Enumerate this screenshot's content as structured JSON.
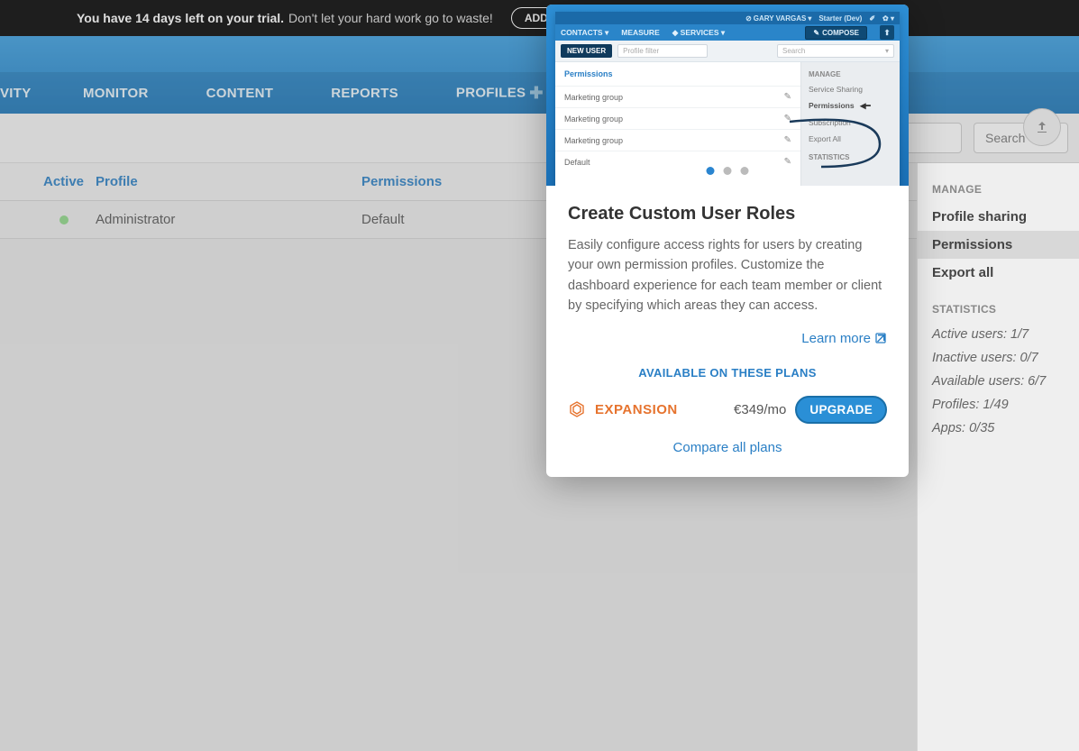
{
  "trial": {
    "bold": "You have 14 days left on your trial.",
    "light": "Don't let your hard work go to waste!",
    "add_button": "ADD BI"
  },
  "nav": {
    "tabs": [
      "VITY",
      "MONITOR",
      "CONTENT",
      "REPORTS",
      "PROFILES"
    ]
  },
  "toolbar": {
    "search_placeholder": "Search"
  },
  "table": {
    "headers": {
      "active": "Active",
      "profile": "Profile",
      "permissions": "Permissions"
    },
    "rows": [
      {
        "profile": "Administrator",
        "permissions": "Default"
      }
    ]
  },
  "sidebar": {
    "manage_title": "MANAGE",
    "manage_items": [
      "Profile sharing",
      "Permissions",
      "Export all"
    ],
    "stats_title": "STATISTICS",
    "stats": [
      "Active users: 1/7",
      "Inactive users: 0/7",
      "Available users: 6/7",
      "Profiles: 1/49",
      "Apps: 0/35"
    ]
  },
  "modal": {
    "mock": {
      "user": "GARY VARGAS",
      "env": "Starter (Dev)",
      "nav": [
        "CONTACTS",
        "MEASURE",
        "SERVICES"
      ],
      "compose": "COMPOSE",
      "new_user": "NEW USER",
      "profile_filter": "Profile filter",
      "search": "Search",
      "permissions": "Permissions",
      "rows": [
        "Marketing group",
        "Marketing group",
        "Marketing group",
        "Default"
      ],
      "manage": "MANAGE",
      "manage_items": [
        "Service Sharing",
        "Permissions",
        "Subscription",
        "Export All"
      ],
      "statistics": "STATISTICS"
    },
    "title": "Create Custom User Roles",
    "description": "Easily configure access rights for users by creating your own permission profiles. Customize the dashboard experience for each team member or client by specifying which areas they can access.",
    "learn_more": "Learn more",
    "plans_title": "AVAILABLE ON THESE PLANS",
    "plan_name": "EXPANSION",
    "plan_price": "€349/mo",
    "upgrade": "UPGRADE",
    "compare": "Compare all plans"
  }
}
